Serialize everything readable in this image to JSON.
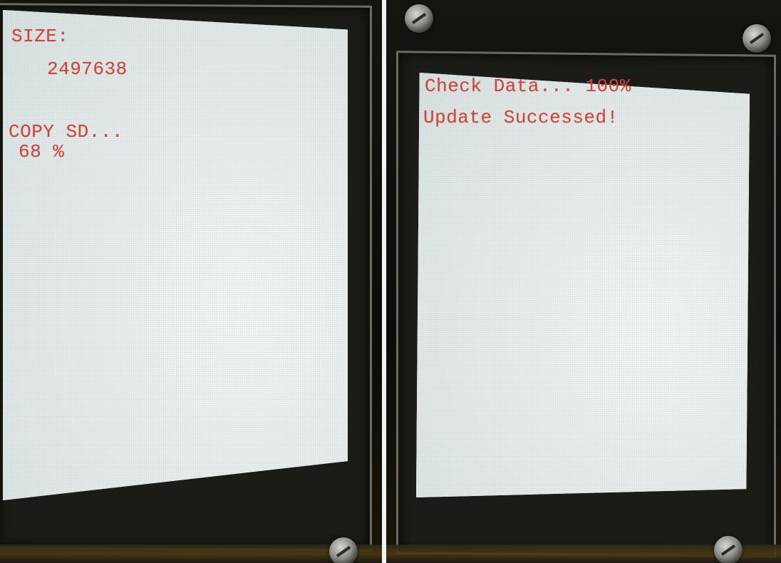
{
  "left_photo": {
    "lines": [
      "SIZE:",
      "2497638",
      "COPY SD...",
      "68 %"
    ],
    "progress_percent": 68
  },
  "right_photo": {
    "lines": [
      "Check Data... 100%",
      "Update Successed!"
    ],
    "progress_percent": 100
  },
  "colors": {
    "lcd_text": "#c9473f",
    "lcd_background": "#e9eeec",
    "bezel": "#1b1c17",
    "divider": "#f2f2f2"
  }
}
